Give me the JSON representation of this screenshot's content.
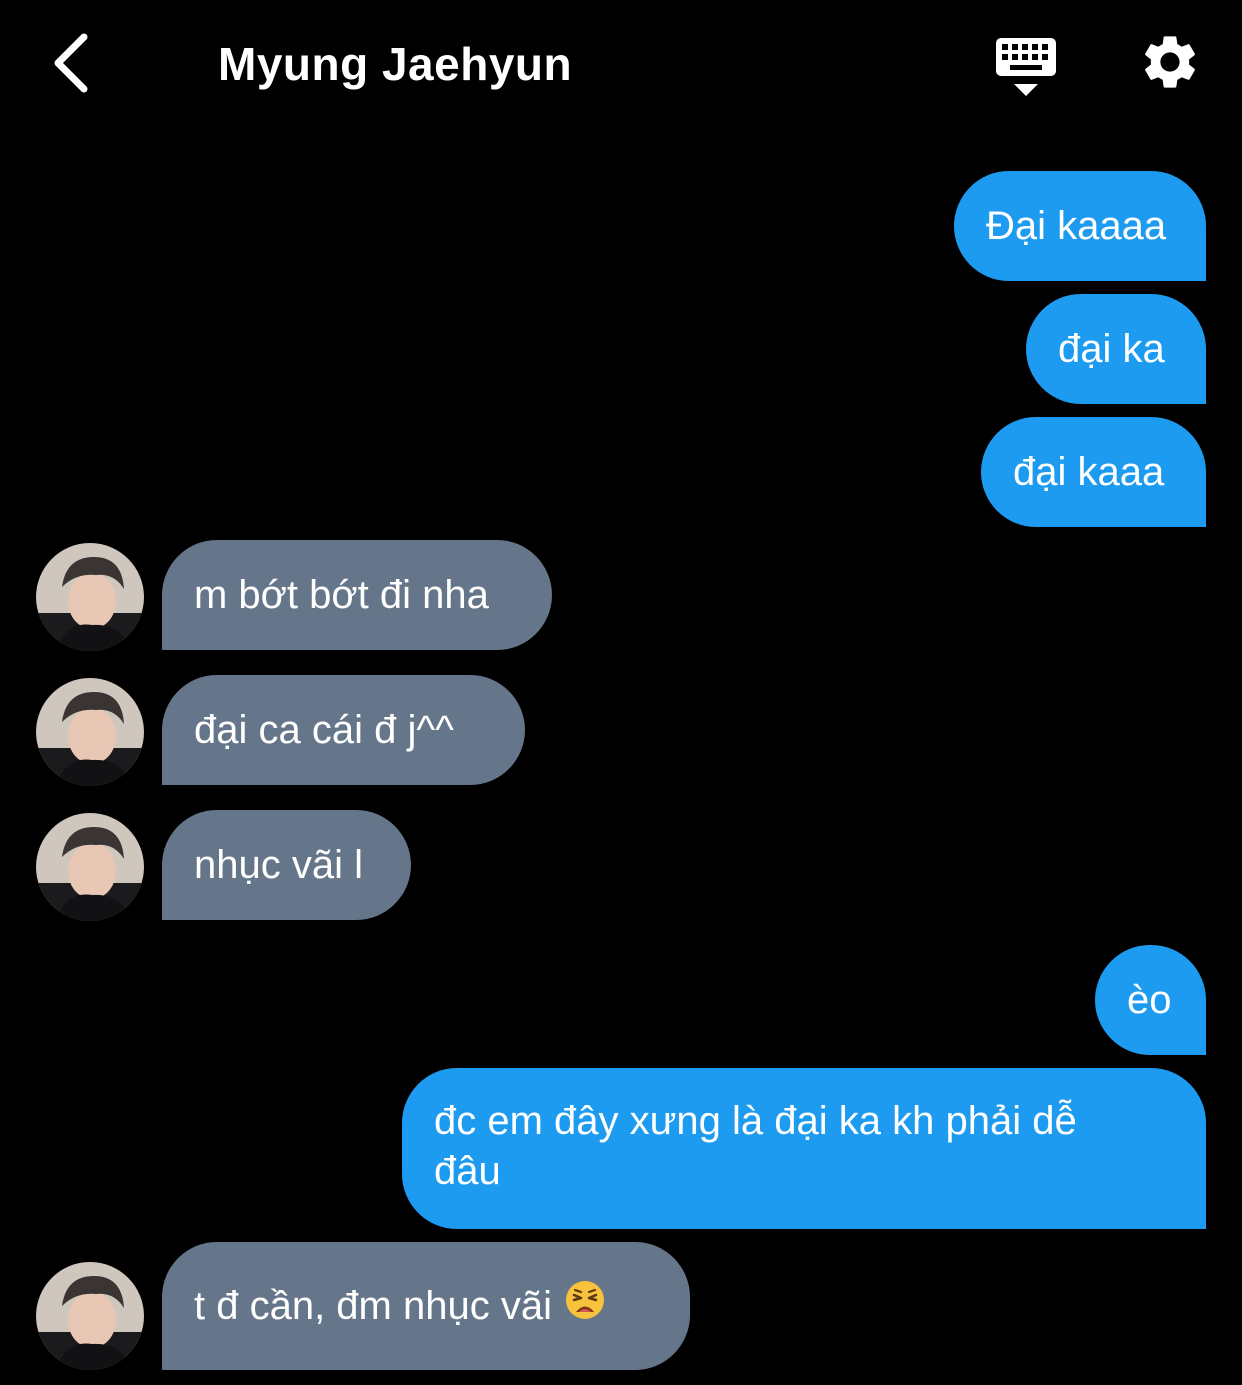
{
  "header": {
    "title": "Myung Jaehyun",
    "back_icon": "chevron-left-icon",
    "keyboard_icon": "keyboard-hide-icon",
    "settings_icon": "gear-icon"
  },
  "colors": {
    "background": "#000000",
    "sent_bubble": "#1d9bf0",
    "received_bubble": "#66768a",
    "text": "#ffffff"
  },
  "messages": [
    {
      "direction": "sent",
      "text": "Đại kaaaa"
    },
    {
      "direction": "sent",
      "text": "đại ka"
    },
    {
      "direction": "sent",
      "text": "đại kaaa"
    },
    {
      "direction": "received",
      "text": "m bớt bớt đi nha"
    },
    {
      "direction": "received",
      "text": "đại ca cái đ j^^"
    },
    {
      "direction": "received",
      "text": "nhục vãi l"
    },
    {
      "direction": "sent",
      "text": "èo"
    },
    {
      "direction": "sent",
      "text": "đc em đây xưng là đại ka kh phải dễ đâu"
    },
    {
      "direction": "received",
      "text": "t đ cần, đm nhục vãi",
      "emoji": "weary-face"
    }
  ]
}
